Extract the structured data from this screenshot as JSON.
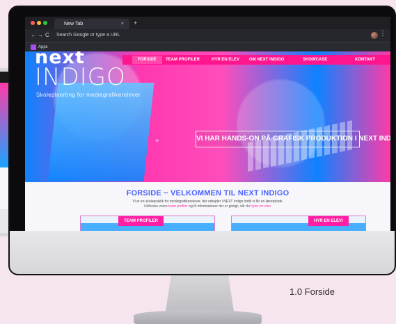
{
  "browser": {
    "tab_title": "New Tab",
    "tab_close": "×",
    "new_tab": "+",
    "nav_back": "←",
    "nav_forward": "→",
    "nav_reload": "C",
    "address_placeholder": "Search Google or type a URL",
    "bookmarks": {
      "apps_label": "Apps"
    },
    "menu_icon": "⋮"
  },
  "site": {
    "logo_top": "next",
    "logo_main": "INDIGO",
    "logo_sub": "Skoleplaerting for mediegrafikerelever",
    "nav": [
      {
        "label": "FORSIDE",
        "active": true
      },
      {
        "label": "TEAM PROFILER"
      },
      {
        "label": "HYR EN ELEV"
      },
      {
        "label": "OM NEXT INDIGO"
      },
      {
        "label": "SHOWCASE"
      },
      {
        "label": "KONTAKT"
      }
    ],
    "hero_cta": "VI HAR HANDS-ON PÅ GRAFISK PRODUKTION I NEXT INDIGO",
    "hero_marker": "+",
    "welcome_title": "FORSIDE ~ VELKOMMEN TIL NEXT INDIGO",
    "welcome_desc": "Vi er en skolepraktik for mediegrafikerelever, der arbejder i NEXT Indigo indtil vi får en lærerplads.",
    "welcome_hint_prefix": "Udforske vores",
    "welcome_hint_link1": "team profiler",
    "welcome_hint_middle": "og få informationer der er givtigt, når du",
    "welcome_hint_link2": "hyrer en elev.",
    "cards": {
      "left_button": "TEAM PROFILER",
      "right_button": "HYR EN ELEV!"
    }
  },
  "hardware": {
    "apple_logo": "",
    "caption": "1.0 Forside"
  },
  "colors": {
    "pink": "#ff2ea6",
    "blue": "#0e82ff",
    "monitor_black": "#0b0b0d",
    "stand_silver": "#c9c9ce"
  }
}
